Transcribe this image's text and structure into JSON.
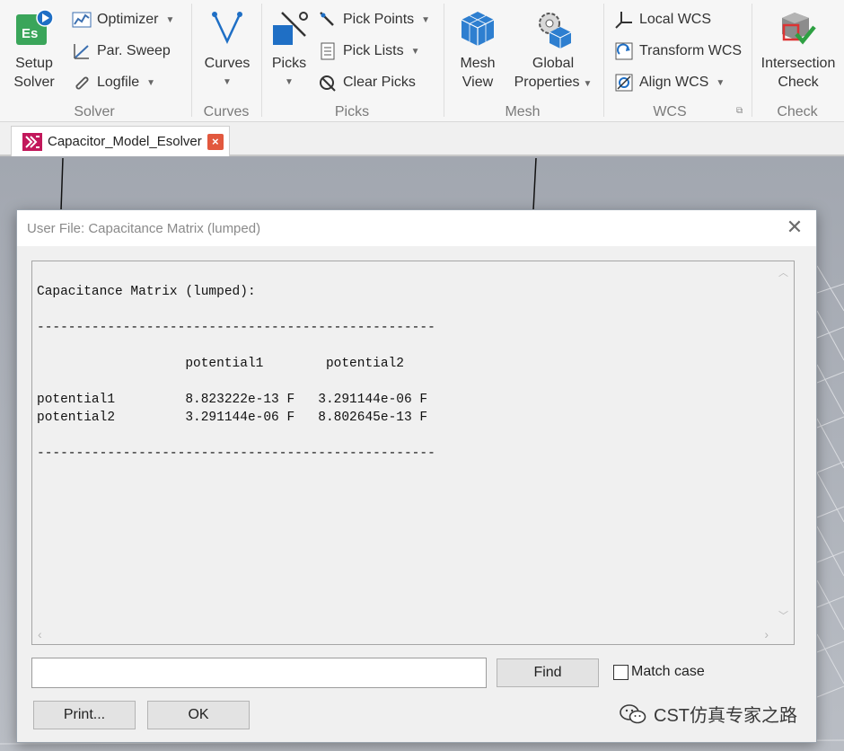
{
  "ribbon": {
    "solver": {
      "setup_label_1": "Setup",
      "setup_label_2": "Solver",
      "optimizer": "Optimizer",
      "par_sweep": "Par. Sweep",
      "logfile": "Logfile",
      "group": "Solver"
    },
    "curves": {
      "label": "Curves",
      "group": "Curves"
    },
    "picks": {
      "label": "Picks",
      "pick_points": "Pick Points",
      "pick_lists": "Pick Lists",
      "clear_picks": "Clear Picks",
      "group": "Picks"
    },
    "mesh": {
      "mesh_view_1": "Mesh",
      "mesh_view_2": "View",
      "global_props_1": "Global",
      "global_props_2": "Properties",
      "group": "Mesh"
    },
    "wcs": {
      "local_wcs": "Local WCS",
      "transform_wcs": "Transform WCS",
      "align_wcs": "Align WCS",
      "group": "WCS"
    },
    "check": {
      "intersection_1": "Intersection",
      "intersection_2": "Check",
      "group": "Check"
    },
    "icons": {
      "setup_solver": "setup-solver-icon",
      "optimizer": "optimizer-icon",
      "par_sweep": "par-sweep-icon",
      "logfile": "logfile-icon",
      "curves": "curves-icon",
      "picks": "picks-icon",
      "pick_points": "pick-points-icon",
      "pick_lists": "pick-lists-icon",
      "clear_picks": "clear-picks-icon",
      "mesh_view": "mesh-view-icon",
      "global_properties": "global-properties-icon",
      "local_wcs": "local-wcs-icon",
      "transform_wcs": "transform-wcs-icon",
      "align_wcs": "align-wcs-icon",
      "intersection_check": "intersection-check-icon"
    }
  },
  "doc_tab": {
    "title": "Capacitor_Model_Esolver",
    "close": "×"
  },
  "dialog": {
    "title": "User File: Capacitance Matrix (lumped)",
    "close": "✕",
    "content_lines": [
      "Capacitance Matrix (lumped):",
      "",
      "---------------------------------------------------",
      "",
      "                   potential1        potential2",
      "",
      "potential1         8.823222e-13 F   3.291144e-06 F",
      "potential2         3.291144e-06 F   8.802645e-13 F",
      "",
      "---------------------------------------------------"
    ],
    "find_value": "",
    "find_button": "Find",
    "match_case": "Match case",
    "print_button": "Print...",
    "ok_button": "OK"
  },
  "watermark": {
    "text": "CST仿真专家之路"
  },
  "colors": {
    "ribbon_bg": "#f6f6f6",
    "accent_blue": "#1f6fc5",
    "setup_green": "#3aa55a",
    "tab_close": "#e2583e",
    "viewport": "#a9adb5"
  }
}
